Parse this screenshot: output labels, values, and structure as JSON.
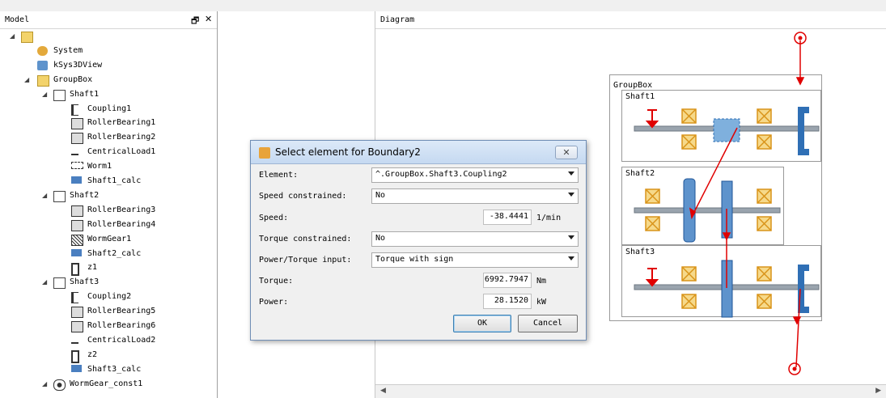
{
  "model_panel": {
    "title": "Model",
    "float_glyph": "🗗",
    "close_glyph": "✕",
    "tree": [
      {
        "label": "",
        "icon": "folder-open-icon",
        "expanded": true
      },
      {
        "label": "System",
        "icon": "system-icon"
      },
      {
        "label": "kSys3DView",
        "icon": "view3d-icon"
      },
      {
        "label": "GroupBox",
        "icon": "groupbox-icon",
        "expanded": true
      },
      {
        "label": "Shaft1",
        "icon": "shaft-icon",
        "expanded": true
      },
      {
        "label": "Coupling1",
        "icon": "coupling-icon"
      },
      {
        "label": "RollerBearing1",
        "icon": "bearing-icon"
      },
      {
        "label": "RollerBearing2",
        "icon": "bearing-icon"
      },
      {
        "label": "CentricalLoad1",
        "icon": "load-icon"
      },
      {
        "label": "Worm1",
        "icon": "worm-icon"
      },
      {
        "label": "Shaft1_calc",
        "icon": "calc-icon"
      },
      {
        "label": "Shaft2",
        "icon": "shaft-icon",
        "expanded": true
      },
      {
        "label": "RollerBearing3",
        "icon": "bearing-icon"
      },
      {
        "label": "RollerBearing4",
        "icon": "bearing-icon"
      },
      {
        "label": "WormGear1",
        "icon": "wormgear-icon"
      },
      {
        "label": "Shaft2_calc",
        "icon": "calc-icon"
      },
      {
        "label": "z1",
        "icon": "gear-icon"
      },
      {
        "label": "Shaft3",
        "icon": "shaft-icon",
        "expanded": true
      },
      {
        "label": "Coupling2",
        "icon": "coupling-icon"
      },
      {
        "label": "RollerBearing5",
        "icon": "bearing-icon"
      },
      {
        "label": "RollerBearing6",
        "icon": "bearing-icon"
      },
      {
        "label": "CentricalLoad2",
        "icon": "load-icon"
      },
      {
        "label": "z2",
        "icon": "gear-icon"
      },
      {
        "label": "Shaft3_calc",
        "icon": "calc-icon"
      },
      {
        "label": "WormGear_const1",
        "icon": "connection-icon",
        "expanded": true
      }
    ]
  },
  "diagram_panel": {
    "title": "Diagram",
    "groupbox_label": "GroupBox",
    "shafts": [
      "Shaft1",
      "Shaft2",
      "Shaft3"
    ]
  },
  "dialog": {
    "title": "Select element for Boundary2",
    "close_glyph": "✕",
    "fields": {
      "element_label": "Element:",
      "element_value": "^.GroupBox.Shaft3.Coupling2",
      "speed_constrained_label": "Speed constrained:",
      "speed_constrained_value": "No",
      "speed_label": "Speed:",
      "speed_value": "-38.4441",
      "speed_unit": "1/min",
      "torque_constrained_label": "Torque constrained:",
      "torque_constrained_value": "No",
      "power_torque_input_label": "Power/Torque input:",
      "power_torque_input_value": "Torque with sign",
      "torque_label": "Torque:",
      "torque_value": "6992.7947",
      "torque_unit": "Nm",
      "power_label": "Power:",
      "power_value": "28.1520",
      "power_unit": "kW"
    },
    "ok_label": "OK",
    "cancel_label": "Cancel"
  },
  "colors": {
    "force_red": "#e00000",
    "bearing_orange": "#e8a020",
    "shaft_grey": "#9aa4ae",
    "gear_blue": "#2f6fb5"
  }
}
